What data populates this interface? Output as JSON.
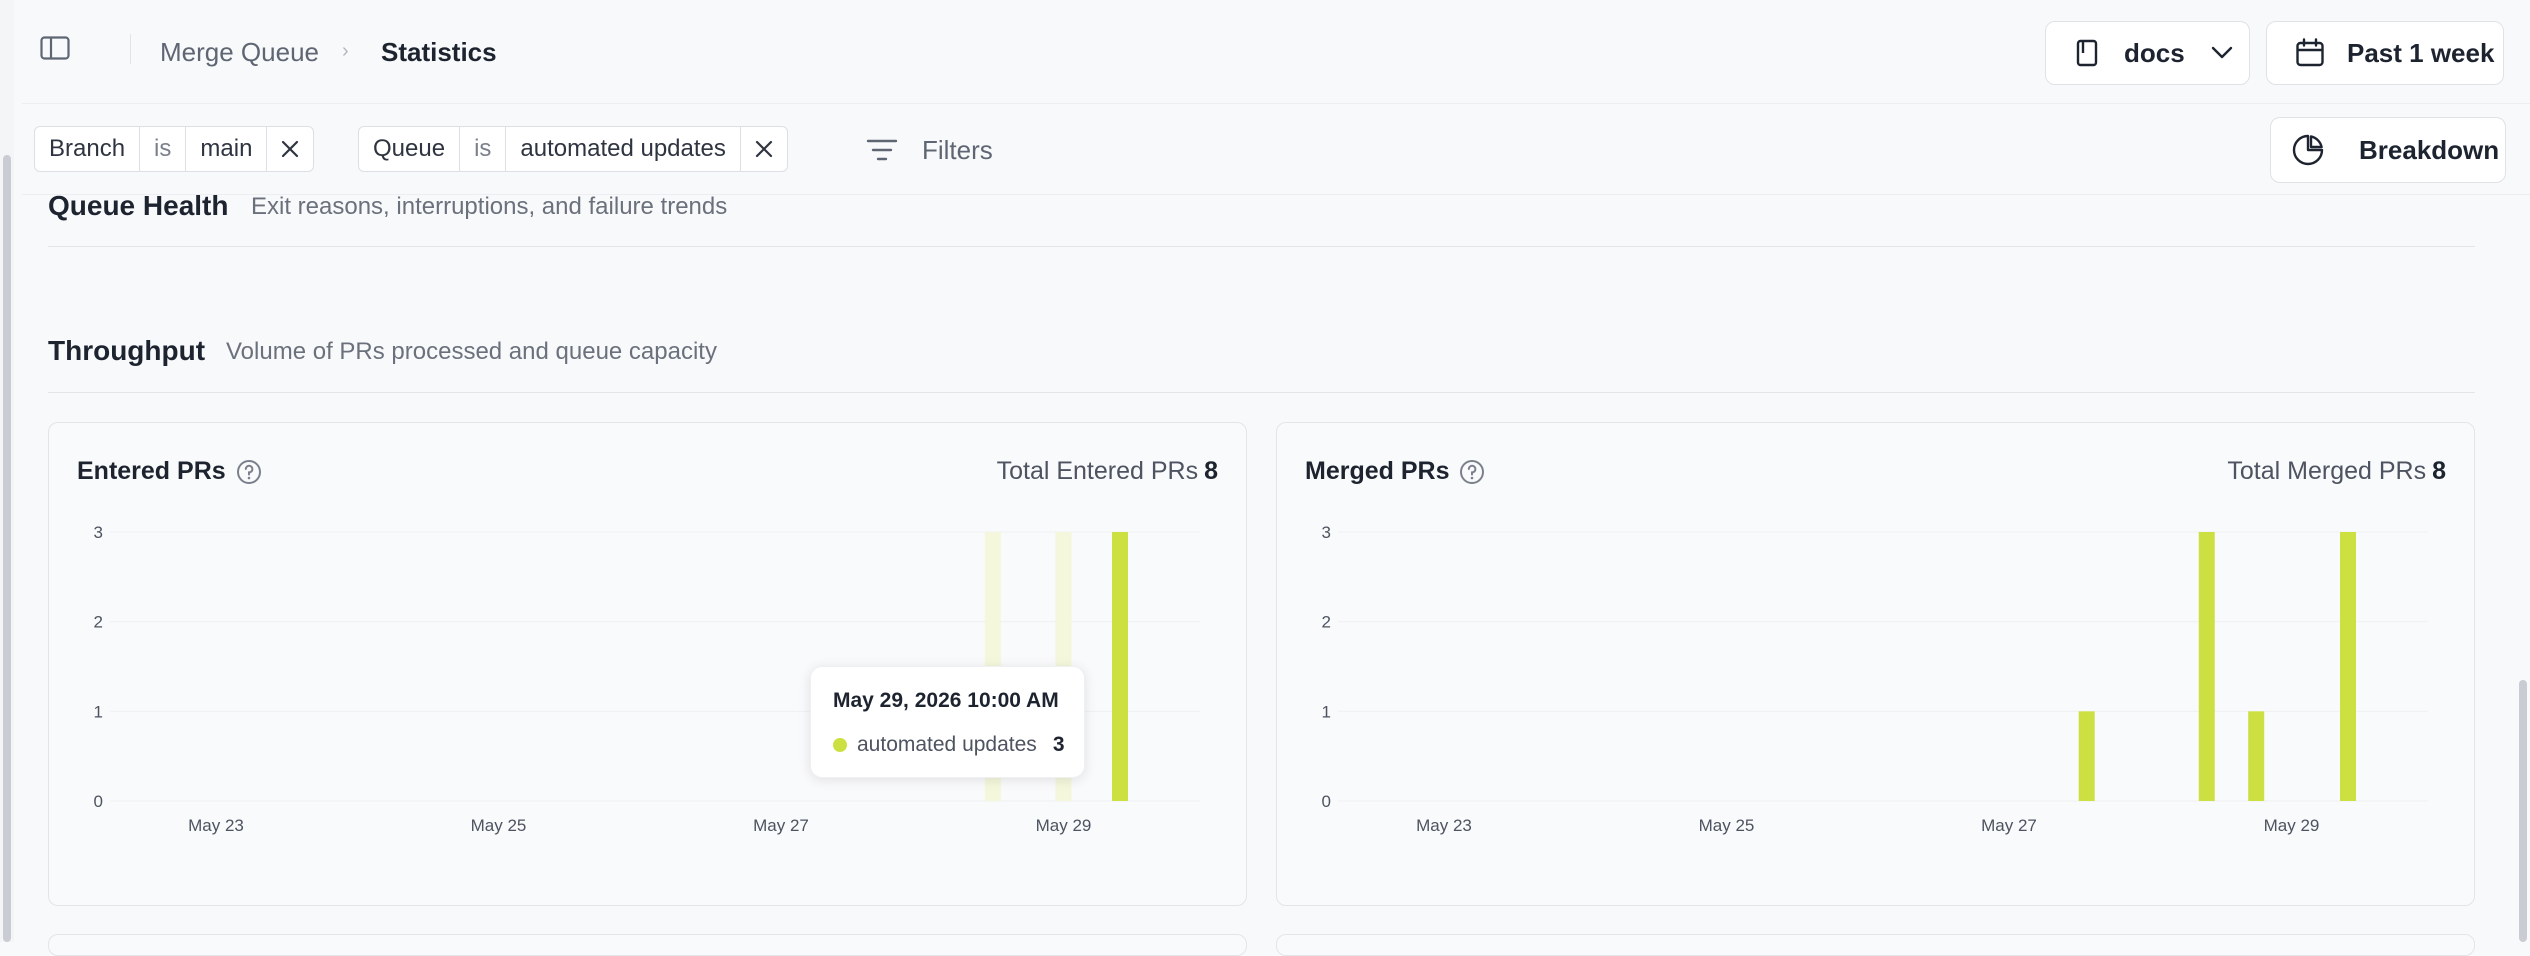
{
  "header": {
    "breadcrumb_root": "Merge Queue",
    "breadcrumb_separator": "›",
    "breadcrumb_current": "Statistics",
    "repo_select": "docs",
    "date_range": "Past 1 week"
  },
  "filters": [
    {
      "field": "Branch",
      "op": "is",
      "value": "main"
    },
    {
      "field": "Queue",
      "op": "is",
      "value": "automated updates"
    }
  ],
  "filters_button": "Filters",
  "breakdown_button": "Breakdown",
  "sections": {
    "queue_health": {
      "title": "Queue Health",
      "desc": "Exit reasons, interruptions, and failure trends"
    },
    "throughput": {
      "title": "Throughput",
      "desc": "Volume of PRs processed and queue capacity"
    }
  },
  "cards": {
    "entered": {
      "title": "Entered PRs",
      "total_label": "Total Entered PRs",
      "total_value": "8"
    },
    "merged": {
      "title": "Merged PRs",
      "total_label": "Total Merged PRs",
      "total_value": "8"
    }
  },
  "tooltip": {
    "date": "May 29, 2026 10:00 AM",
    "series": "automated updates",
    "value": "3"
  },
  "colors": {
    "accent": "#cde042",
    "accent_faded": "#f4f7dc"
  },
  "chart_data": [
    {
      "type": "bar",
      "ylim": [
        0,
        3
      ],
      "yticks": [
        0,
        1,
        2,
        3
      ],
      "x_tick_labels": [
        "May 23",
        "May 25",
        "May 27",
        "May 29"
      ],
      "x_tick_days": [
        23,
        25,
        27,
        29
      ],
      "series": [
        {
          "name": "automated updates",
          "x_days": [
            28.5,
            29.0,
            29.4
          ],
          "values": [
            0,
            0,
            3
          ],
          "highlight": [
            true,
            true,
            false
          ]
        }
      ]
    },
    {
      "type": "bar",
      "ylim": [
        0,
        3
      ],
      "yticks": [
        0,
        1,
        2,
        3
      ],
      "x_tick_labels": [
        "May 23",
        "May 25",
        "May 27",
        "May 29"
      ],
      "x_tick_days": [
        23,
        25,
        27,
        29
      ],
      "series": [
        {
          "name": "automated updates",
          "x_days": [
            27.55,
            28.4,
            28.75,
            29.4
          ],
          "values": [
            1,
            3,
            1,
            3
          ],
          "highlight": [
            false,
            false,
            false,
            false
          ]
        }
      ]
    }
  ]
}
